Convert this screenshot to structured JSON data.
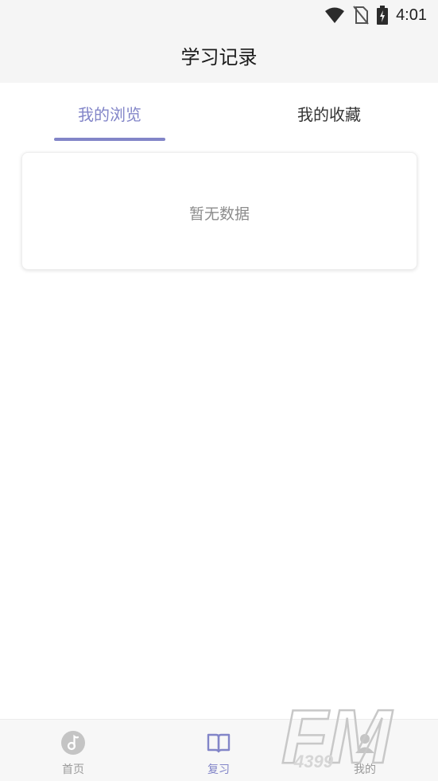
{
  "status_bar": {
    "time": "4:01",
    "icons": [
      "wifi-icon",
      "no-sim-icon",
      "battery-charging-icon"
    ]
  },
  "header": {
    "title": "学习记录"
  },
  "tabs": [
    {
      "label": "我的浏览",
      "active": true
    },
    {
      "label": "我的收藏",
      "active": false
    }
  ],
  "empty_state": {
    "text": "暂无数据"
  },
  "bottom_nav": [
    {
      "label": "首页",
      "icon": "music-note-icon",
      "active": false
    },
    {
      "label": "复习",
      "icon": "book-icon",
      "active": true
    },
    {
      "label": "我的",
      "icon": "person-icon",
      "active": false
    }
  ],
  "watermark": {
    "brand": "FM",
    "sub": "4399"
  },
  "colors": {
    "accent": "#8285c8",
    "header_bg": "#f5f5f5",
    "inactive": "#9a9a9a"
  }
}
